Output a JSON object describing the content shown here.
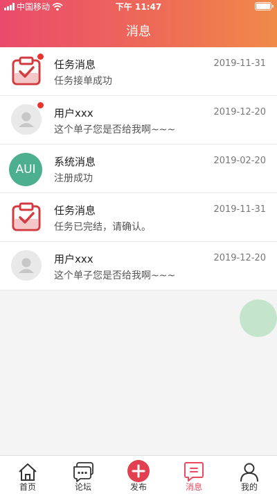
{
  "status_bar": {
    "carrier": "中国移动",
    "time": "下午 11:47"
  },
  "header": {
    "title": "消息"
  },
  "messages": [
    {
      "type": "task",
      "name": "任务消息",
      "date": "2019-11-31",
      "text": "任务接单成功",
      "unread": true
    },
    {
      "type": "user",
      "name": "用户xxx",
      "date": "2019-12-20",
      "text": "这个单子您是否给我啊~~~",
      "unread": true
    },
    {
      "type": "system",
      "avatar_text": "AUI",
      "name": "系统消息",
      "date": "2019-02-20",
      "text": "注册成功",
      "unread": false
    },
    {
      "type": "task",
      "name": "任务消息",
      "date": "2019-11-31",
      "text": "任务已完结，请确认。",
      "unread": false
    },
    {
      "type": "user",
      "name": "用户xxx",
      "date": "2019-12-20",
      "text": "这个单子您是否给我啊~~~",
      "unread": false
    }
  ],
  "tabs": [
    {
      "label": "首页",
      "icon": "home-icon"
    },
    {
      "label": "论坛",
      "icon": "forum-icon"
    },
    {
      "label": "发布",
      "icon": "publish-plus-icon"
    },
    {
      "label": "消息",
      "icon": "message-icon",
      "active": true
    },
    {
      "label": "我的",
      "icon": "profile-icon"
    }
  ],
  "colors": {
    "accent": "#e84a5f",
    "header_start": "#ea4a6b",
    "header_end": "#f08a49",
    "unread_dot": "#e8352e",
    "system_avatar": "#4caf90"
  }
}
